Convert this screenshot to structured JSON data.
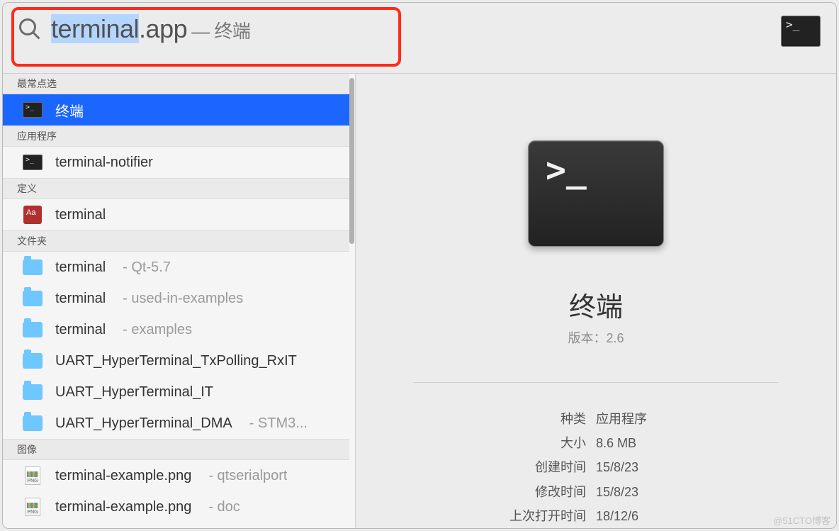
{
  "search": {
    "typed_selected": "terminal",
    "typed_rest": ".app",
    "suffix": "— 终端",
    "input_value": "terminal.app"
  },
  "sections": {
    "top_hit": "最常点选",
    "apps": "应用程序",
    "definitions": "定义",
    "folders": "文件夹",
    "images": "图像"
  },
  "results": {
    "top_hit": {
      "name": "终端"
    },
    "apps": [
      {
        "name": "terminal-notifier"
      }
    ],
    "definitions": [
      {
        "name": "terminal"
      }
    ],
    "folders": [
      {
        "name": "terminal",
        "sub": "- Qt-5.7"
      },
      {
        "name": "terminal",
        "sub": "- used-in-examples"
      },
      {
        "name": "terminal",
        "sub": "- examples"
      },
      {
        "name": "UART_HyperTerminal_TxPolling_RxIT",
        "sub": ""
      },
      {
        "name": "UART_HyperTerminal_IT",
        "sub": ""
      },
      {
        "name": "UART_HyperTerminal_DMA",
        "sub": "- STM3..."
      }
    ],
    "images": [
      {
        "name": "terminal-example.png",
        "sub": "- qtserialport"
      },
      {
        "name": "terminal-example.png",
        "sub": "- doc"
      }
    ]
  },
  "preview": {
    "title": "终端",
    "version_label": "版本：",
    "version_value": "2.6",
    "meta": [
      {
        "k": "种类",
        "v": "应用程序"
      },
      {
        "k": "大小",
        "v": "8.6 MB"
      },
      {
        "k": "创建时间",
        "v": "15/8/23"
      },
      {
        "k": "修改时间",
        "v": "15/8/23"
      },
      {
        "k": "上次打开时间",
        "v": "18/12/6"
      }
    ]
  },
  "watermark": "@51CTO博客"
}
